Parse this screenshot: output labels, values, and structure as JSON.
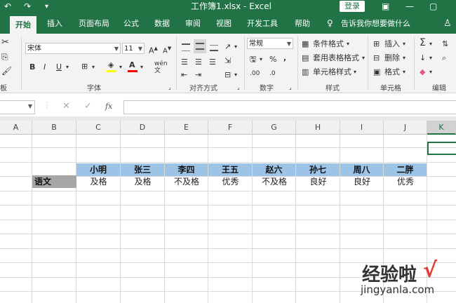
{
  "window": {
    "title": "工作簿1.xlsx  -  Excel",
    "login_label": "登录"
  },
  "tabs": [
    {
      "label": "开始",
      "active": true
    },
    {
      "label": "插入"
    },
    {
      "label": "页面布局"
    },
    {
      "label": "公式"
    },
    {
      "label": "数据"
    },
    {
      "label": "审阅"
    },
    {
      "label": "视图"
    },
    {
      "label": "开发工具"
    },
    {
      "label": "帮助"
    }
  ],
  "tell_me": "告诉我你想要做什么",
  "ribbon": {
    "font_name": "宋体",
    "font_size": "11",
    "number_format": "常规",
    "groups": {
      "font": "字体",
      "alignment": "对齐方式",
      "number": "数字",
      "styles": "样式",
      "cells": "单元格",
      "editing": "编辑",
      "clipboard_partial": "板"
    },
    "styles_buttons": [
      "条件格式",
      "套用表格格式",
      "单元格样式"
    ],
    "cells_buttons": [
      "插入",
      "删除",
      "格式"
    ]
  },
  "formula_bar": {
    "name_box": "",
    "formula": "",
    "fx": "fx"
  },
  "sheet": {
    "columns": [
      "A",
      "B",
      "C",
      "D",
      "E",
      "F",
      "G",
      "H",
      "I",
      "J",
      "K"
    ],
    "header_row": [
      "小明",
      "张三",
      "李四",
      "王五",
      "赵六",
      "孙七",
      "周八",
      "二胖"
    ],
    "row_label": "语文",
    "row_values": [
      "及格",
      "及格",
      "不及格",
      "优秀",
      "不及格",
      "良好",
      "良好",
      "优秀"
    ],
    "header_fill": "#9dc3e6",
    "label_fill": "#a6a6a6"
  },
  "watermark": {
    "text": "经验啦",
    "url": "jingyanla.com",
    "check": "√"
  }
}
